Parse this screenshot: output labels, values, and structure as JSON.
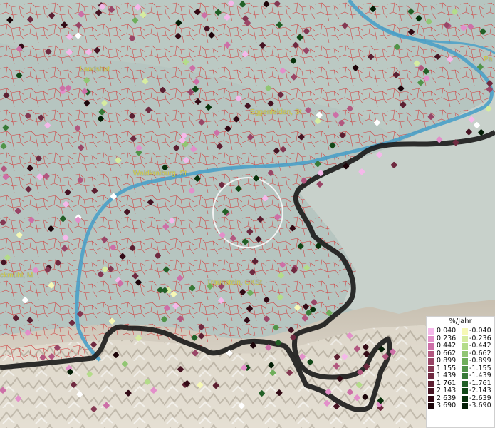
{
  "places": [
    {
      "name": "Landshut"
    },
    {
      "name": "Eggenfelden, St"
    },
    {
      "name": "Waldkraiburg, St"
    },
    {
      "name": "Traunstein, GKSt"
    },
    {
      "name": "ckmühl, M"
    },
    {
      "name": "Pa"
    }
  ],
  "legend": {
    "title": "%/Jahr",
    "positive": [
      {
        "label": "0.040",
        "color": "#f5b8ea"
      },
      {
        "label": "0.236",
        "color": "#e38fca"
      },
      {
        "label": "0.442",
        "color": "#cd6fa7"
      },
      {
        "label": "0.662",
        "color": "#b2577f"
      },
      {
        "label": "0.899",
        "color": "#994566"
      },
      {
        "label": "1.155",
        "color": "#843852"
      },
      {
        "label": "1.439",
        "color": "#6f2a40"
      },
      {
        "label": "1.761",
        "color": "#5c1f31"
      },
      {
        "label": "2.143",
        "color": "#471423"
      },
      {
        "label": "2.639",
        "color": "#330a15"
      },
      {
        "label": "3.690",
        "color": "#1c0409"
      }
    ],
    "negative": [
      {
        "label": "-0.040",
        "color": "#f6f8b6"
      },
      {
        "label": "-0.236",
        "color": "#d6eca0"
      },
      {
        "label": "-0.442",
        "color": "#b4dc8a"
      },
      {
        "label": "-0.662",
        "color": "#91c673"
      },
      {
        "label": "-0.899",
        "color": "#6fae5b"
      },
      {
        "label": "-1.155",
        "color": "#519449"
      },
      {
        "label": "-1.439",
        "color": "#377a37"
      },
      {
        "label": "-1.761",
        "color": "#226027"
      },
      {
        "label": "-2.143",
        "color": "#124818"
      },
      {
        "label": "-2.639",
        "color": "#08320c"
      },
      {
        "label": "-3.690",
        "color": "#031d05"
      }
    ]
  },
  "colors": {
    "river": "#4aa0c8",
    "boundary": "#1a1a1a",
    "district_lines": "#d23a3a",
    "highlight_circle": "#f2f2f2",
    "label": "#d8d24a"
  }
}
